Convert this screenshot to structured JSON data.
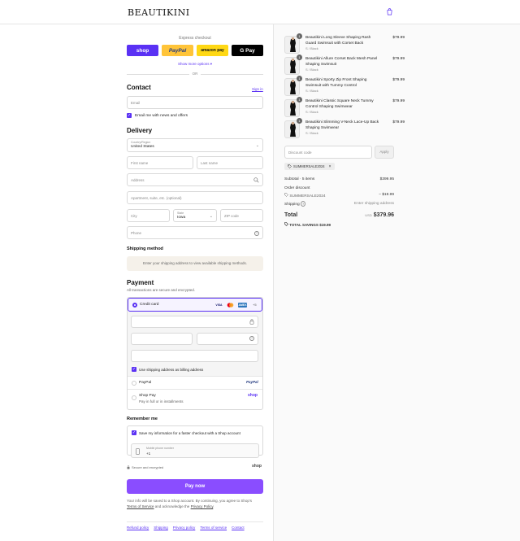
{
  "brand": {
    "logo": "BEAUTIKINI"
  },
  "express": {
    "title": "Express checkout",
    "buttons": {
      "shop": "shop",
      "paypal": "PayPal",
      "amazon": "amazon pay",
      "gpay": "G Pay"
    },
    "more_options": "Show more options ▾",
    "or": "OR"
  },
  "contact": {
    "heading": "Contact",
    "sign_in": "Sign in",
    "email_placeholder": "Email",
    "news_label": "Email me with news and offers"
  },
  "delivery": {
    "heading": "Delivery",
    "country_label": "Country/Region",
    "country_value": "United States",
    "first_name": "First name",
    "last_name": "Last name",
    "address": "Address",
    "apartment": "Apartment, suite, etc. (optional)",
    "city": "City",
    "state_label": "State",
    "state_value": "Iowa",
    "zip": "ZIP code",
    "phone": "Phone"
  },
  "shipping_method": {
    "heading": "Shipping method",
    "note": "Enter your shipping address to view available shipping methods."
  },
  "payment": {
    "heading": "Payment",
    "subtitle": "All transactions are secure and encrypted.",
    "credit_card": "Credit card",
    "more_cards": "+5",
    "card_logos": {
      "visa": "VISA",
      "amex": "AMEX"
    },
    "billing_same": "Use shipping address as billing address",
    "paypal": "PayPal",
    "paypal_logo": "PayPal",
    "shop_pay": "Shop Pay",
    "shop_pay_sub": "Pay in full or in installments",
    "shop_logo": "shop"
  },
  "remember": {
    "heading": "Remember me",
    "save_label": "Save my information for a faster checkout with a Shop account",
    "mobile_label": "Mobile phone number",
    "mobile_value": "+1",
    "secure": "Secure and encrypted",
    "shop_logo": "shop"
  },
  "pay_now": "Pay now",
  "terms": {
    "text": "Your info will be saved to a Shop account. By continuing, you agree to Shop's",
    "tos": "Terms of Service",
    "and": "and acknowledge the",
    "privacy": "Privacy Policy",
    "end": "."
  },
  "footer": {
    "links": [
      "Refund policy",
      "Shipping",
      "Privacy policy",
      "Terms of service",
      "Contact"
    ]
  },
  "order": {
    "items": [
      {
        "qty": "1",
        "name": "Beautikini Long Sleeve Shaping Rash Guard Swimsuit with Corset Back",
        "variant": "S / Black",
        "price": "$79.99"
      },
      {
        "qty": "1",
        "name": "Beautikini Allure Corset Back Mesh Panel Shaping Swimsuit",
        "variant": "S / Black",
        "price": "$79.99"
      },
      {
        "qty": "1",
        "name": "Beautikini Sporty Zip Front Shaping Swimsuit with Tummy Control",
        "variant": "S / Black",
        "price": "$79.99"
      },
      {
        "qty": "1",
        "name": "Beautikini Classic Square Neck Tummy Control Shaping Swimwear",
        "variant": "S / Black",
        "price": "$79.99"
      },
      {
        "qty": "1",
        "name": "Beautikini Slimming V-Neck Lace-Up Back Shaping Swimwear",
        "variant": "S / Black",
        "price": "$79.99"
      }
    ],
    "discount_placeholder": "Discount code",
    "apply": "Apply",
    "code": "SUMMERSALE2024",
    "subtotal_label": "Subtotal · 5 items",
    "subtotal_value": "$399.95",
    "order_discount": "Order discount",
    "discount_code": "SUMMERSALE2024",
    "discount_value": "− $19.99",
    "shipping_label": "Shipping",
    "shipping_value": "Enter shipping address",
    "total_label": "Total",
    "currency": "USD",
    "total_value": "$379.96",
    "savings_label": "TOTAL SAVINGS",
    "savings_value": "$19.99"
  }
}
